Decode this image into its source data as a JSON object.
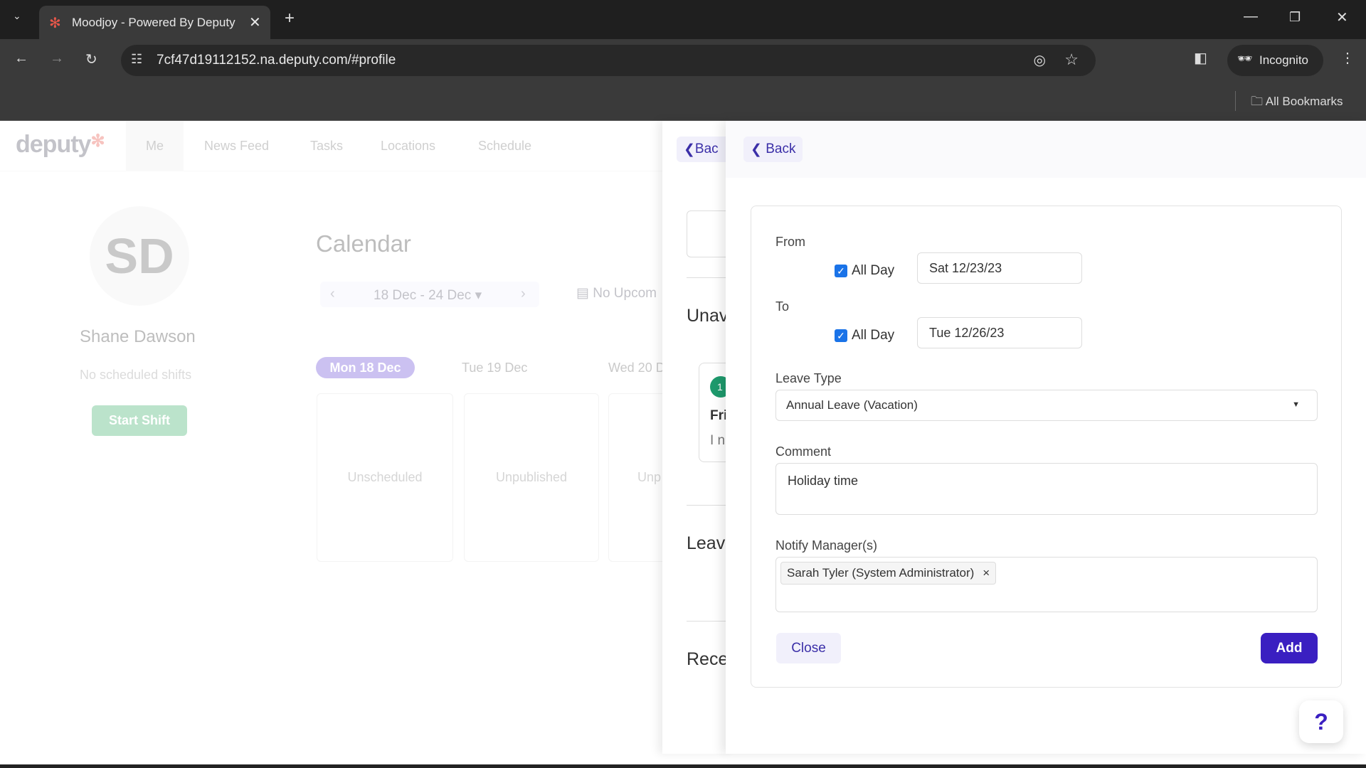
{
  "browser": {
    "tab_title": "Moodjoy - Powered By Deputy",
    "url": "7cf47d19112152.na.deputy.com/#profile",
    "profile": "Incognito",
    "bookmarks": "All Bookmarks"
  },
  "nav": {
    "logo": "deputy",
    "items": [
      "Me",
      "News Feed",
      "Tasks",
      "Locations",
      "Schedule"
    ],
    "active": "Me"
  },
  "profile": {
    "initials": "SD",
    "name": "Shane Dawson",
    "shifts": "No scheduled shifts",
    "start_shift": "Start Shift"
  },
  "calendar": {
    "title": "Calendar",
    "range": "18 Dec - 24 Dec",
    "upcoming": "No Upcom",
    "days": [
      "Mon 18 Dec",
      "Tue 19 Dec",
      "Wed 20 D"
    ],
    "columns": [
      "Unscheduled",
      "Unpublished",
      "Unp"
    ]
  },
  "panel1": {
    "back": "Bac",
    "sections": [
      "Unav",
      "Leave",
      "Rece"
    ],
    "item_day": "Fri",
    "item_text": "I n",
    "badge": "1"
  },
  "form": {
    "back": "Back",
    "from_label": "From",
    "to_label": "To",
    "all_day": "All Day",
    "from_all_day": true,
    "to_all_day": true,
    "from_date": "Sat 12/23/23",
    "to_date": "Tue 12/26/23",
    "leave_type_label": "Leave Type",
    "leave_type": "Annual Leave (Vacation)",
    "comment_label": "Comment",
    "comment": "Holiday time",
    "notify_label": "Notify Manager(s)",
    "managers": [
      "Sarah Tyler (System Administrator)"
    ],
    "close": "Close",
    "add": "Add",
    "help": "?"
  },
  "colors": {
    "accent": "#3a1fc1",
    "start_shift": "#3cb06a",
    "active_day": "#6c4fd6"
  }
}
